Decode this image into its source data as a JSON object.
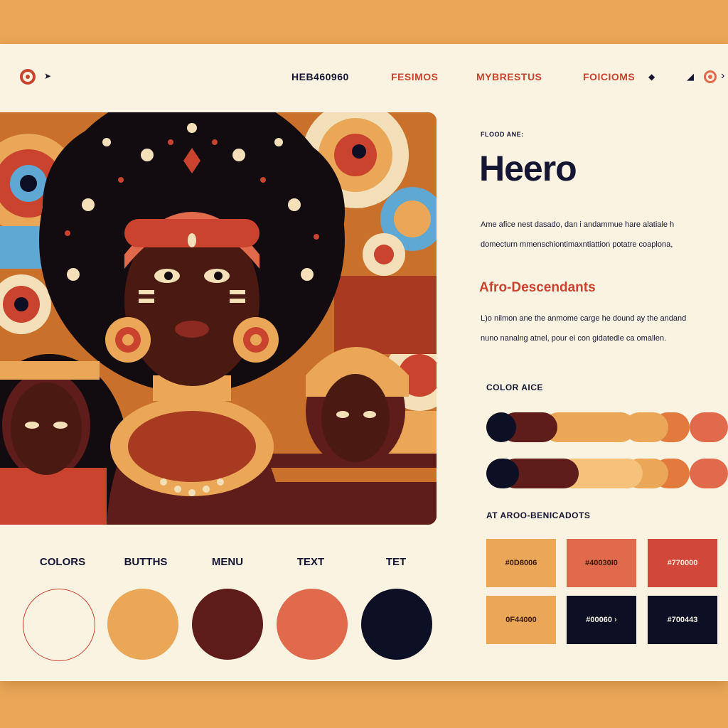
{
  "nav": {
    "links": [
      "HEB460960",
      "FESIMOS",
      "MYBRESTUS",
      "FOICIOMS"
    ],
    "icons": [
      "logo-icon",
      "cursor-icon",
      "diamond-icon",
      "pin-icon",
      "ring-icon",
      "chevron-icon"
    ]
  },
  "hero": {
    "eyebrow": "FLOOD ANE:",
    "title": "Heero",
    "paragraph": [
      "Ame afice nest dasado, dan i andammue hare alatiale h",
      "domecturn mmenschiontimaxntiattion potatre coaplona,"
    ],
    "subheading": "Afro-Descendants",
    "paragraph2": [
      "L)o nilmon ane the anmome carge he dound ay the andand",
      "nuno nanalng atnel, pour ei con gidatedle ca omallen."
    ]
  },
  "color_section": {
    "label": "COLOR AICE",
    "bars": [
      [
        "#0d0f24",
        "#5e1c1a",
        "#e9a757",
        "#e9a757",
        "#e37a3d",
        "#e26a4c"
      ],
      [
        "#0d0f24",
        "#5e1c1a",
        "#f4c27a",
        "#e9a757",
        "#e37a3d",
        "#e26a4c"
      ]
    ]
  },
  "swatches": {
    "title": "AT AROO-BENICADOTS",
    "items": [
      {
        "code": "#0D8006",
        "bg": "#e9a757",
        "fg": "#3a1a0a"
      },
      {
        "code": "#40030I0",
        "bg": "#e26a4c",
        "fg": "#3a1a0a"
      },
      {
        "code": "#770000",
        "bg": "#d1473a",
        "fg": "#fbe8d8"
      },
      {
        "code": "0F44000",
        "bg": "#e9a757",
        "fg": "#3a1a0a"
      },
      {
        "code": "#00060 ›",
        "bg": "#0d0f24",
        "fg": "#f5f0e6"
      },
      {
        "code": "#700443",
        "bg": "#0d0f24",
        "fg": "#f5f0e6"
      }
    ]
  },
  "palette": {
    "labels": [
      "COLORS",
      "BUTTHS",
      "MENU",
      "TEXT",
      "TET"
    ],
    "colors": [
      "#fbf3e2",
      "#e9a757",
      "#5e1c1a",
      "#e26a4c",
      "#0d0f24"
    ]
  }
}
